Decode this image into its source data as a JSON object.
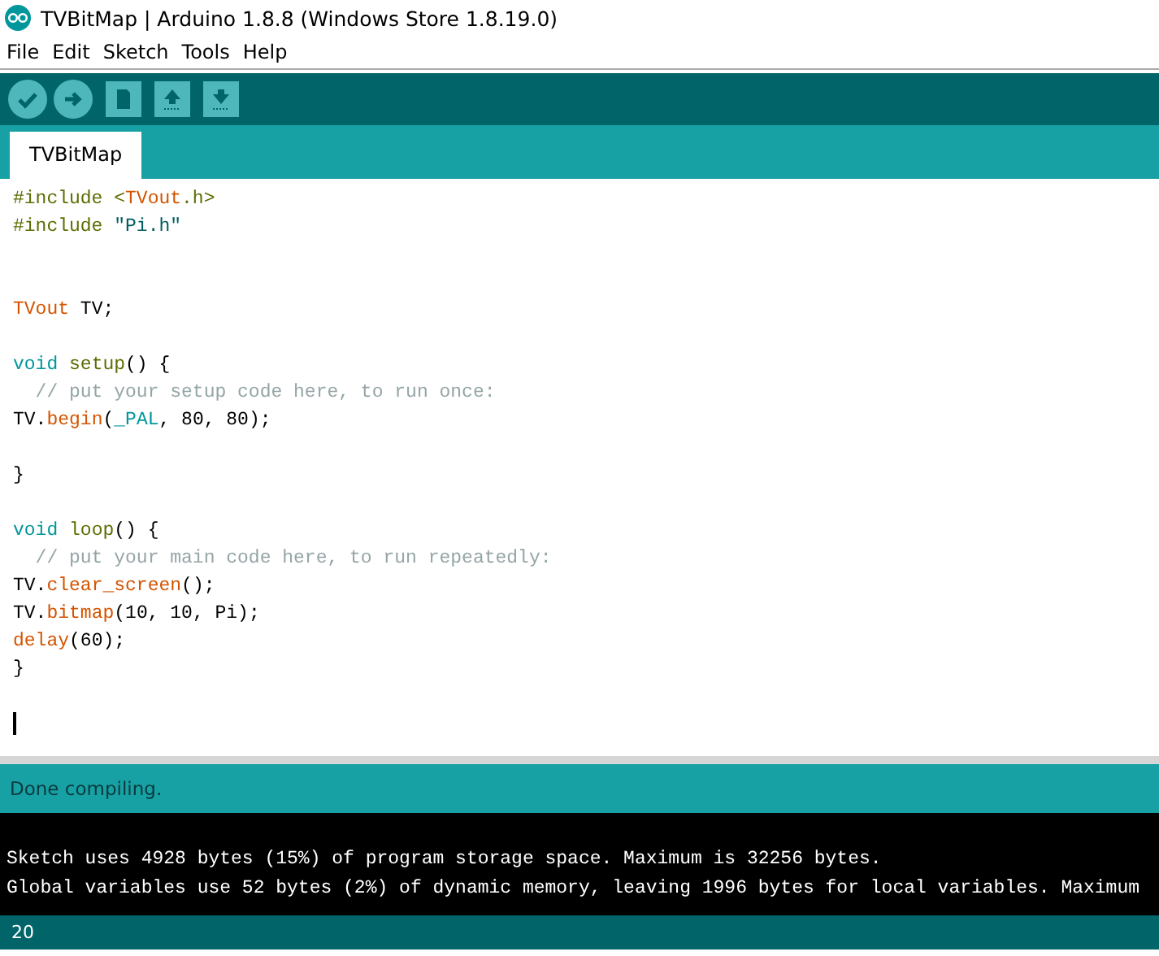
{
  "window": {
    "title": "TVBitMap | Arduino 1.8.8 (Windows Store 1.8.19.0)"
  },
  "menu": [
    "File",
    "Edit",
    "Sketch",
    "Tools",
    "Help"
  ],
  "toolbar": [
    {
      "kind": "verify"
    },
    {
      "kind": "upload"
    },
    {
      "kind": "new"
    },
    {
      "kind": "open"
    },
    {
      "kind": "save"
    }
  ],
  "tabs": [
    {
      "label": "TVBitMap",
      "selected": true
    }
  ],
  "code": [
    {
      "kind": "code",
      "segments": [
        {
          "text": "#include <",
          "kind": "pre"
        },
        {
          "text": "TVout",
          "kind": "type"
        },
        {
          "text": ".h>",
          "kind": "pre"
        }
      ]
    },
    {
      "kind": "code",
      "segments": [
        {
          "text": "#include ",
          "kind": "pre"
        },
        {
          "text": "\"Pi.h\"",
          "kind": "string"
        }
      ]
    },
    {
      "kind": "blank"
    },
    {
      "kind": "blank"
    },
    {
      "kind": "code",
      "segments": [
        {
          "text": "TVout",
          "kind": "type"
        },
        {
          "text": " TV;",
          "kind": "plain"
        }
      ]
    },
    {
      "kind": "blank"
    },
    {
      "kind": "code",
      "segments": [
        {
          "text": "void ",
          "kind": "keyword"
        },
        {
          "text": "setup",
          "kind": "struct"
        },
        {
          "text": "() {",
          "kind": "plain"
        }
      ]
    },
    {
      "kind": "code",
      "segments": [
        {
          "text": "  // put your setup code here, to run once:",
          "kind": "comment"
        }
      ]
    },
    {
      "kind": "code",
      "segments": [
        {
          "text": "TV.",
          "kind": "plain"
        },
        {
          "text": "begin",
          "kind": "func"
        },
        {
          "text": "(",
          "kind": "plain"
        },
        {
          "text": "_PAL",
          "kind": "keyword"
        },
        {
          "text": ", 80, 80);",
          "kind": "plain"
        }
      ]
    },
    {
      "kind": "blank"
    },
    {
      "kind": "code",
      "segments": [
        {
          "text": "}",
          "kind": "plain"
        }
      ]
    },
    {
      "kind": "blank"
    },
    {
      "kind": "code",
      "segments": [
        {
          "text": "void ",
          "kind": "keyword"
        },
        {
          "text": "loop",
          "kind": "struct"
        },
        {
          "text": "() {",
          "kind": "plain"
        }
      ]
    },
    {
      "kind": "code",
      "segments": [
        {
          "text": "  // put your main code here, to run repeatedly:",
          "kind": "comment"
        }
      ]
    },
    {
      "kind": "code",
      "segments": [
        {
          "text": "TV.",
          "kind": "plain"
        },
        {
          "text": "clear_screen",
          "kind": "func"
        },
        {
          "text": "();",
          "kind": "plain"
        }
      ]
    },
    {
      "kind": "code",
      "segments": [
        {
          "text": "TV.",
          "kind": "plain"
        },
        {
          "text": "bitmap",
          "kind": "func"
        },
        {
          "text": "(10, 10, Pi);",
          "kind": "plain"
        }
      ]
    },
    {
      "kind": "code",
      "segments": [
        {
          "text": "delay",
          "kind": "func"
        },
        {
          "text": "(60);",
          "kind": "plain"
        }
      ]
    },
    {
      "kind": "code",
      "segments": [
        {
          "text": "}",
          "kind": "plain"
        }
      ]
    },
    {
      "kind": "blank"
    },
    {
      "kind": "cursor"
    }
  ],
  "status": "Done compiling.",
  "console": [
    "Sketch uses 4928 bytes (15%) of program storage space. Maximum is 32256 bytes.",
    "Global variables use 52 bytes (2%) of dynamic memory, leaving 1996 bytes for local variables. Maximum"
  ],
  "footer": {
    "line": "20"
  }
}
